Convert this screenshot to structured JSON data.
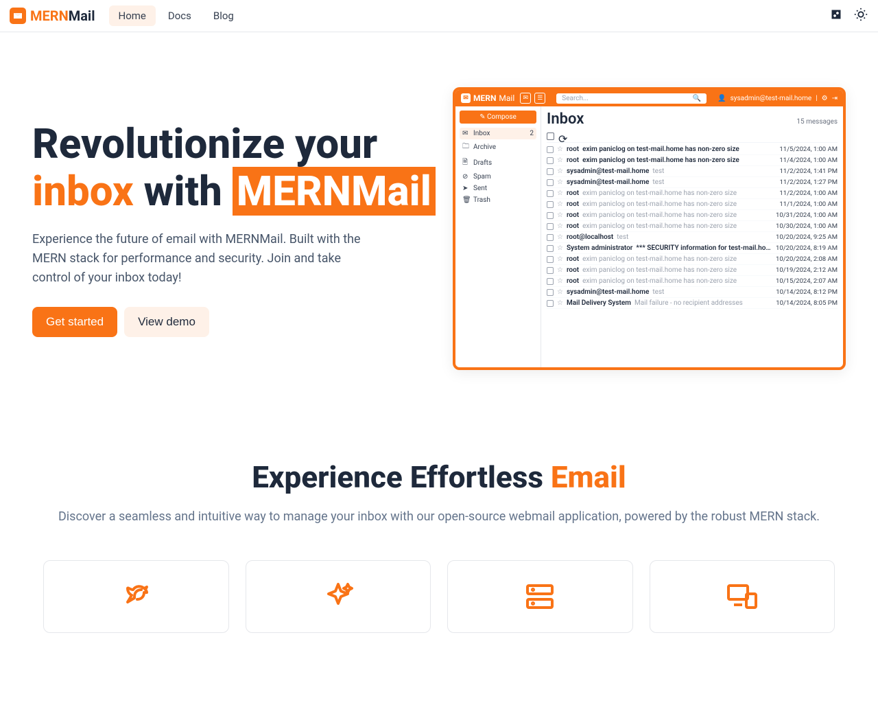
{
  "brand": {
    "mern": "MERN",
    "mail": "Mail"
  },
  "nav": {
    "home": "Home",
    "docs": "Docs",
    "blog": "Blog"
  },
  "hero": {
    "title_line1": "Revolutionize your",
    "title_word_inbox": "inbox",
    "title_word_with": " with ",
    "title_word_brand": "MERNMail",
    "subtitle": "Experience the future of email with MERNMail. Built with the MERN stack for performance and security. Join and take control of your inbox today!",
    "cta_primary": "Get started",
    "cta_secondary": "View demo"
  },
  "mock": {
    "brand_mern": "MERN",
    "brand_mail": "Mail",
    "search_placeholder": "Search...",
    "user": "sysadmin@test-mail.home",
    "compose": "✎ Compose",
    "folders": [
      {
        "label": "Inbox",
        "badge": "2",
        "glyph": "✉",
        "active": true
      },
      {
        "label": "Archive",
        "badge": "",
        "glyph": "🗀",
        "active": false
      },
      {
        "label": "Drafts",
        "badge": "",
        "glyph": "🗎",
        "active": false
      },
      {
        "label": "Spam",
        "badge": "",
        "glyph": "⊘",
        "active": false
      },
      {
        "label": "Sent",
        "badge": "",
        "glyph": "➤",
        "active": false
      },
      {
        "label": "Trash",
        "badge": "",
        "glyph": "🗑",
        "active": false
      }
    ],
    "inbox_title": "Inbox",
    "message_count": "15 messages",
    "rows": [
      {
        "sender": "root",
        "subject": "exim paniclog on test-mail.home has non-zero size",
        "date": "11/5/2024, 1:00 AM",
        "bold": true
      },
      {
        "sender": "root",
        "subject": "exim paniclog on test-mail.home has non-zero size",
        "date": "11/4/2024, 1:00 AM",
        "bold": true
      },
      {
        "sender": "sysadmin@test-mail.home",
        "subject": "test",
        "date": "11/2/2024, 1:41 PM",
        "bold": false
      },
      {
        "sender": "sysadmin@test-mail.home",
        "subject": "test",
        "date": "11/2/2024, 1:27 PM",
        "bold": false
      },
      {
        "sender": "root",
        "subject": "exim paniclog on test-mail.home has non-zero size",
        "date": "11/2/2024, 1:00 AM",
        "bold": false
      },
      {
        "sender": "root",
        "subject": "exim paniclog on test-mail.home has non-zero size",
        "date": "11/1/2024, 1:00 AM",
        "bold": false
      },
      {
        "sender": "root",
        "subject": "exim paniclog on test-mail.home has non-zero size",
        "date": "10/31/2024, 1:00 AM",
        "bold": false
      },
      {
        "sender": "root",
        "subject": "exim paniclog on test-mail.home has non-zero size",
        "date": "10/30/2024, 1:00 AM",
        "bold": false
      },
      {
        "sender": "root@localhost",
        "subject": "test",
        "date": "10/20/2024, 9:25 AM",
        "bold": false
      },
      {
        "sender": "System administrator",
        "subject": "*** SECURITY information for test-mail.home ***",
        "date": "10/20/2024, 8:19 AM",
        "bold": true
      },
      {
        "sender": "root",
        "subject": "exim paniclog on test-mail.home has non-zero size",
        "date": "10/20/2024, 2:08 AM",
        "bold": false
      },
      {
        "sender": "root",
        "subject": "exim paniclog on test-mail.home has non-zero size",
        "date": "10/19/2024, 2:12 AM",
        "bold": false
      },
      {
        "sender": "root",
        "subject": "exim paniclog on test-mail.home has non-zero size",
        "date": "10/15/2024, 2:07 AM",
        "bold": false
      },
      {
        "sender": "sysadmin@test-mail.home",
        "subject": "test",
        "date": "10/14/2024, 8:12 PM",
        "bold": false
      },
      {
        "sender": "Mail Delivery System",
        "subject": "Mail failure - no recipient addresses",
        "date": "10/14/2024, 8:05 PM",
        "bold": false
      }
    ]
  },
  "section2": {
    "title_part1": "Experience Effortless ",
    "title_part2": "Email",
    "subtitle": "Discover a seamless and intuitive way to manage your inbox with our open-source webmail application, powered by the robust MERN stack."
  }
}
